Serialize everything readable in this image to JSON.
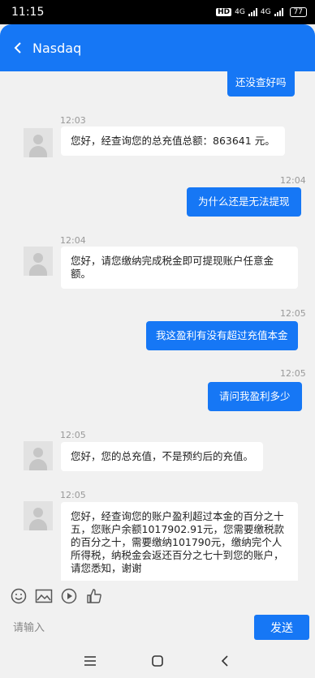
{
  "status": {
    "time": "11:15",
    "hd": "HD",
    "network": "4G",
    "network2": "4G",
    "battery": "77"
  },
  "header": {
    "title": "Nasdaq"
  },
  "messages": [
    {
      "side": "out",
      "text": "还没查好吗"
    },
    {
      "side": "in",
      "time": "12:03",
      "text": "您好，经查询您的总充值总额：863641 元。"
    },
    {
      "side": "out",
      "time": "12:04",
      "text": "为什么还是无法提现"
    },
    {
      "side": "in",
      "time": "12:04",
      "text": "您好，请您缴纳完成税金即可提现账户任意金额。"
    },
    {
      "side": "out",
      "time": "12:05",
      "text": "我这盈利有没有超过充值本金"
    },
    {
      "side": "out",
      "time": "12:05",
      "text": "请问我盈利多少"
    },
    {
      "side": "in",
      "time": "12:05",
      "text": "您好，您的总充值，不是预约后的充值。"
    },
    {
      "side": "in",
      "time": "12:05",
      "text": "您好，经查询您的账户盈利超过本金的百分之十五，您账户余额1017902.91元，您需要缴税款的百分之十，需要缴纳101790元，缴纳完个人所得税，纳税金会返还百分之七十到您的账户，请您悉知，谢谢"
    }
  ],
  "toolbar": {
    "icons": [
      "smiley-icon",
      "image-icon",
      "video-icon",
      "thumbs-up-icon"
    ]
  },
  "composer": {
    "placeholder": "请输入",
    "send_label": "发送"
  },
  "colors": {
    "accent": "#1677f5",
    "background": "#f1f1f1"
  }
}
